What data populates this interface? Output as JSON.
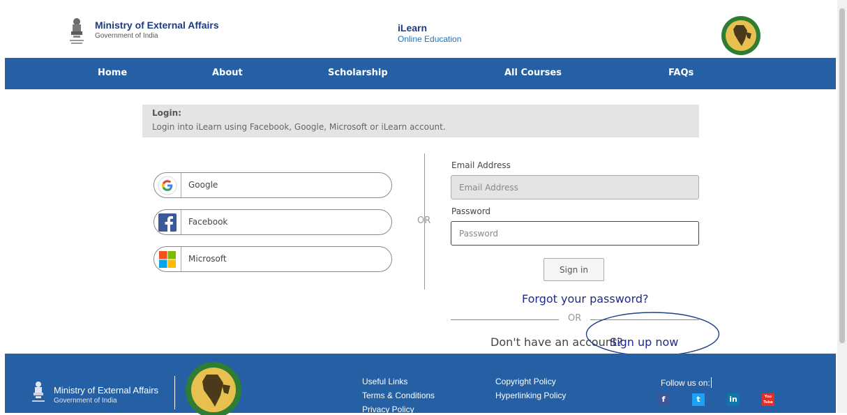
{
  "header": {
    "org_title": "Ministry of External Affairs",
    "org_subtitle": "Government of India",
    "app_title": "iLearn",
    "app_subtitle": "Online Education"
  },
  "nav": {
    "items": [
      "Home",
      "About",
      "Scholarship",
      "All Courses",
      "FAQs"
    ]
  },
  "login": {
    "heading": "Login:",
    "description": "Login into iLearn using Facebook, Google, Microsoft or iLearn account.",
    "social": [
      {
        "label": "Google",
        "icon": "google-icon"
      },
      {
        "label": "Facebook",
        "icon": "facebook-icon"
      },
      {
        "label": "Microsoft",
        "icon": "microsoft-icon"
      }
    ],
    "or_text": "OR",
    "email_label": "Email Address",
    "email_placeholder": "Email Address",
    "password_label": "Password",
    "password_placeholder": "Password",
    "signin_label": "Sign in",
    "forgot_label": "Forgot your password?",
    "or_bottom": "OR",
    "no_account_text": "Don't have an account?",
    "signup_label": "Sign up now"
  },
  "footer": {
    "org_title": "Ministry of External Affairs",
    "org_subtitle": "Government of India",
    "links_col1": [
      "Useful Links",
      "Terms & Conditions",
      "Privacy Policy"
    ],
    "links_col2": [
      "Copyright Policy",
      "Hyperlinking Policy"
    ],
    "follow_label": "Follow us on:",
    "social": [
      {
        "label": "f",
        "icon": "facebook-icon",
        "color": "#3b5998"
      },
      {
        "label": "t",
        "icon": "twitter-icon",
        "color": "#1da1f2"
      },
      {
        "label": "in",
        "icon": "linkedin-icon",
        "color": "#0e76a8"
      },
      {
        "label": "You Tube",
        "icon": "youtube-icon",
        "color": "#e52d27"
      }
    ]
  },
  "colors": {
    "nav_bar": "#2560a4",
    "link": "#1e2a8a",
    "panel": "#e4e4e4"
  }
}
